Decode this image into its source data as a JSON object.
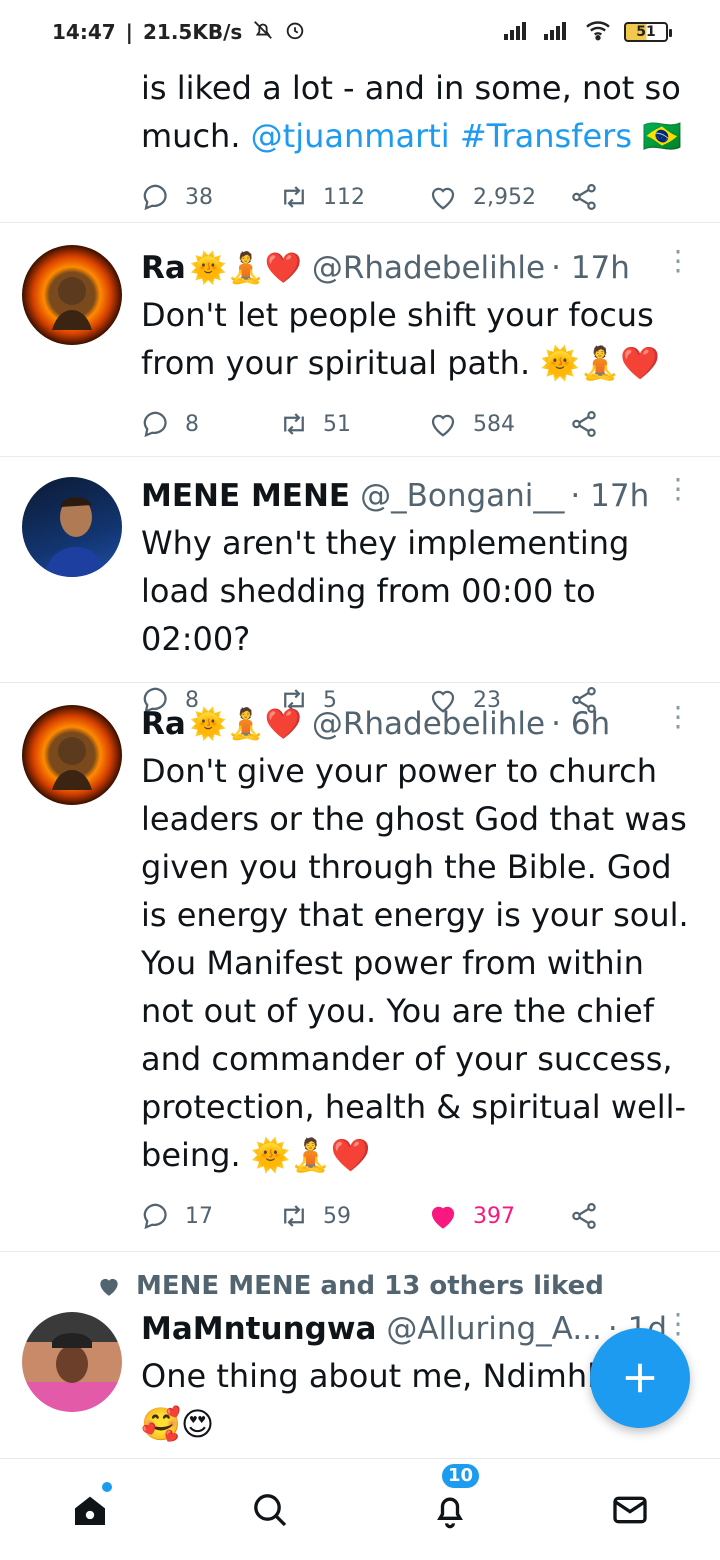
{
  "status": {
    "time": "14:47",
    "speed": "21.5KB/s",
    "battery": "51"
  },
  "tweets": [
    {
      "partial": true,
      "text_parts": [
        "is liked a lot - and in some, not so much. "
      ],
      "mention": "@tjuanmarti",
      "hashtag": "#Transfers",
      "trail_emoji": "🇧🇷",
      "replies": "38",
      "retweets": "112",
      "likes": "2,952"
    },
    {
      "name": "Ra",
      "name_emoji": "🌞🧘❤️",
      "handle": "@Rhadebelihle",
      "time": "· 17h",
      "text": "Don't let people shift your focus from your spiritual path. 🌞🧘❤️",
      "replies": "8",
      "retweets": "51",
      "likes": "584"
    },
    {
      "name": "MENE MENE",
      "handle": "@_Bongani__",
      "time": "· 17h",
      "text": "Why aren't they implementing load shedding from 00:00 to 02:00?",
      "replies": "8",
      "retweets": "5",
      "likes": "23"
    },
    {
      "name": "Ra",
      "name_emoji": "🌞🧘❤️",
      "handle": "@Rhadebelihle",
      "time": "· 6h",
      "text": "Don't give your power to church leaders or the ghost God that was given you through the Bible. God is energy that energy is your soul. You Manifest power from within not out of you. You are the chief and commander of your success, protection, health & spiritual well-being. 🌞🧘❤️",
      "replies": "17",
      "retweets": "59",
      "likes": "397"
    },
    {
      "context": "MENE MENE and 13 others liked",
      "name": "MaMntungwa",
      "handle": "@Alluring_A...",
      "time": "· 1d",
      "text": "One thing about me, Ndimhle",
      "extra_emoji": "🥰😍"
    }
  ],
  "nav": {
    "notifications_badge": "10"
  },
  "icons": [
    "reply-icon",
    "retweet-icon",
    "like-icon",
    "share-icon",
    "home-icon",
    "search-icon",
    "bell-icon",
    "mail-icon",
    "plus-icon"
  ],
  "colors": {
    "accent": "#1d9bf0",
    "like": "#f91880",
    "muted": "#536471"
  }
}
